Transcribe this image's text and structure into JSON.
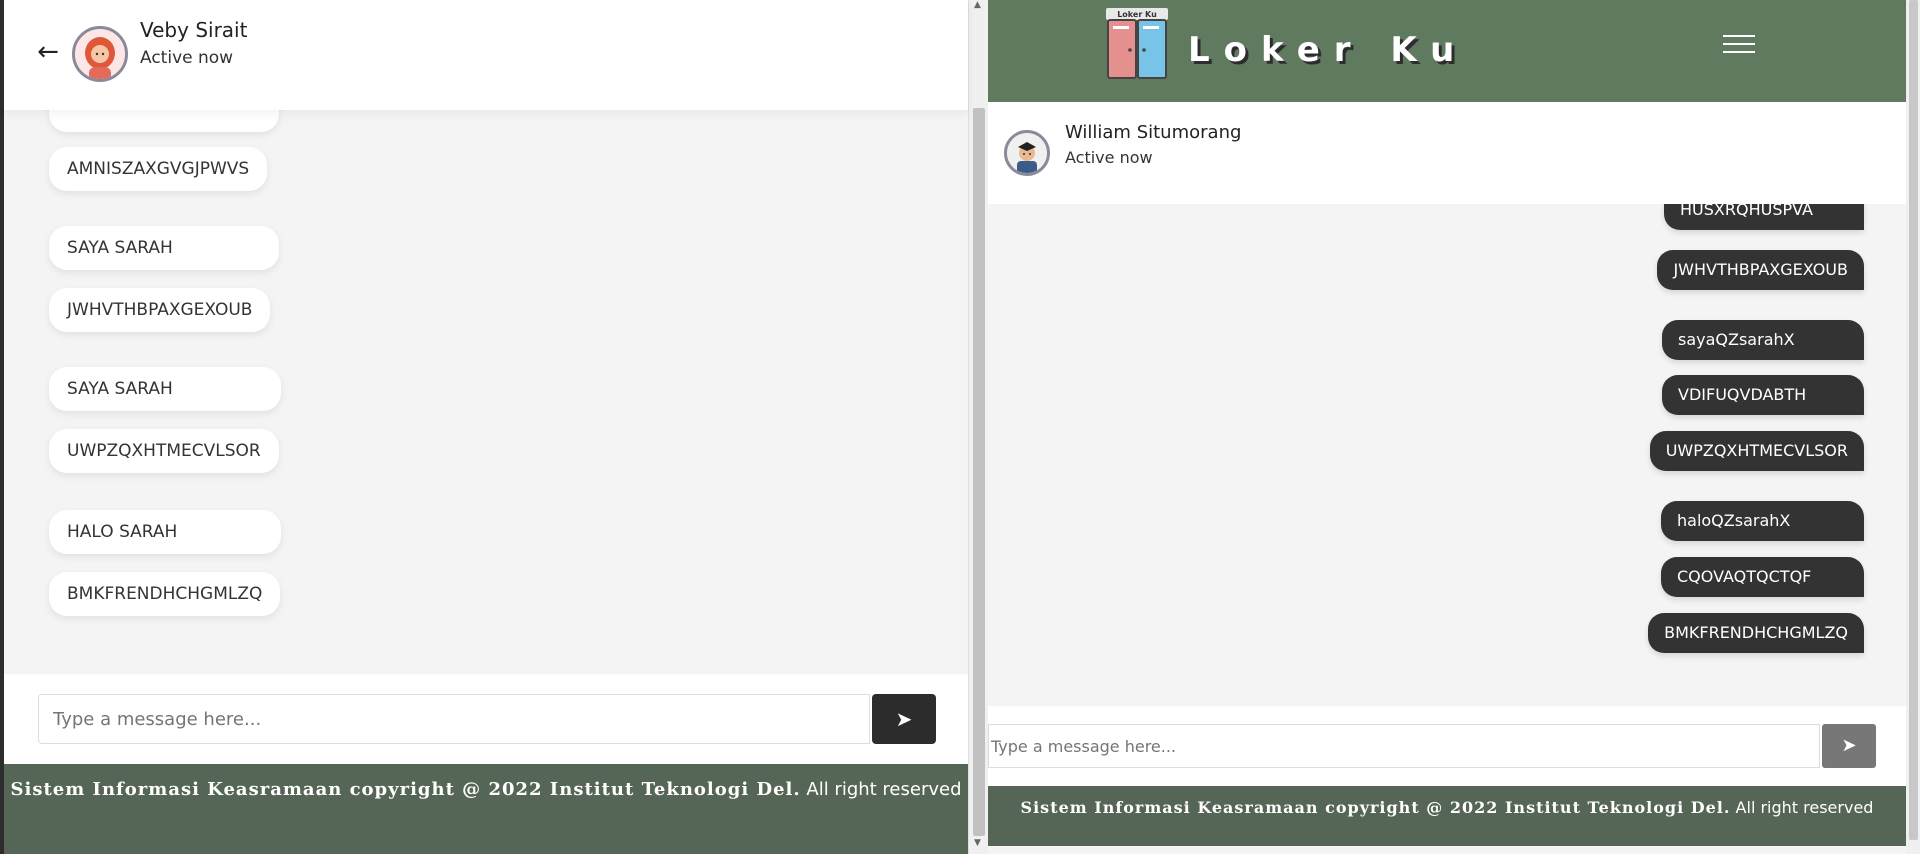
{
  "left": {
    "header": {
      "name": "Veby Sirait",
      "status": "Active now",
      "back_icon": "arrow-left-icon"
    },
    "messages": [
      "AMNISZAXGVGJPWVS",
      "SAYA SARAH",
      "JWHVTHBPAXGEXOUB",
      "SAYA SARAH",
      "UWPZQXHTMECVLSOR",
      "HALO SARAH",
      "BMKFRENDHCHGMLZQ"
    ],
    "input": {
      "placeholder": "Type a message here...",
      "send_icon": "paper-plane-icon"
    },
    "footer": {
      "serif": "Sistem Informasi Keasramaan copyright @ 2022 Institut Teknologi Del.",
      "plain": "All right reserved"
    }
  },
  "right": {
    "nav": {
      "logo_badge": "Loker Ku",
      "logo_text": "Loker Ku",
      "menu_icon": "hamburger-menu-icon"
    },
    "header": {
      "name": "William Situmorang",
      "status": "Active now"
    },
    "messages": [
      "HUSXRQHUSPVA",
      "JWHVTHBPAXGEXOUB",
      "sayaQZsarahX",
      "VDIFUQVDABTH",
      "UWPZQXHTMECVLSOR",
      "haloQZsarahX",
      "CQOVAQTQCTQF",
      "BMKFRENDHCHGMLZQ"
    ],
    "input": {
      "placeholder": "Type a message here...",
      "send_icon": "paper-plane-icon"
    },
    "footer": {
      "serif": "Sistem Informasi Keasramaan copyright @ 2022 Institut Teknologi Del.",
      "plain": "All right reserved"
    }
  },
  "colors": {
    "footer": "#566656",
    "nav": "#5f7a5f",
    "outgoing_bubble": "#333333",
    "incoming_bubble": "#ffffff",
    "send_button_dark": "#2c2c2c"
  }
}
